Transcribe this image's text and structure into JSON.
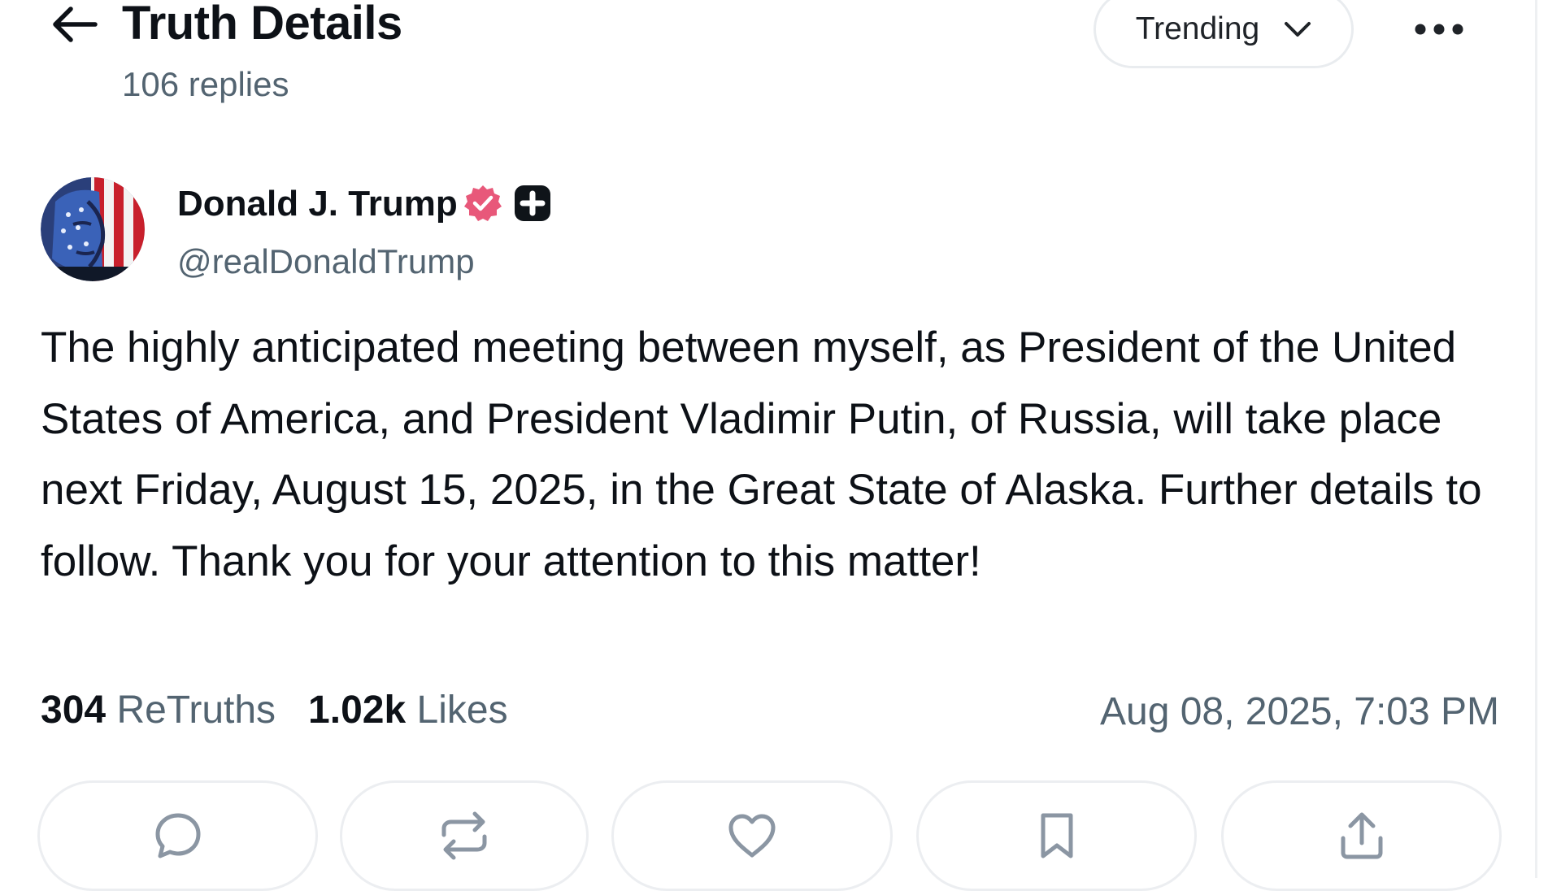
{
  "header": {
    "title": "Truth Details",
    "replies": "106 replies",
    "sort_label": "Trending"
  },
  "author": {
    "name": "Donald J. Trump",
    "handle": "@realDonaldTrump"
  },
  "post": {
    "text": "The highly anticipated meeting between myself, as President of the United States of America, and President Vladimir Putin, of Russia, will take place next Friday, August 15, 2025, in the Great State of Alaska. Further details to follow. Thank you for your attention to this matter!"
  },
  "stats": {
    "retruths_count": "304",
    "retruths_label": "ReTruths",
    "likes_count": "1.02k",
    "likes_label": "Likes",
    "timestamp": "Aug 08, 2025, 7:03 PM"
  },
  "actions": [
    {
      "icon": "comment-icon"
    },
    {
      "icon": "retruth-icon"
    },
    {
      "icon": "heart-icon"
    },
    {
      "icon": "bookmark-icon"
    },
    {
      "icon": "share-icon"
    }
  ],
  "colors": {
    "verified_badge": "#e8587a",
    "secondary_text": "#536471",
    "border": "#eceef1"
  }
}
